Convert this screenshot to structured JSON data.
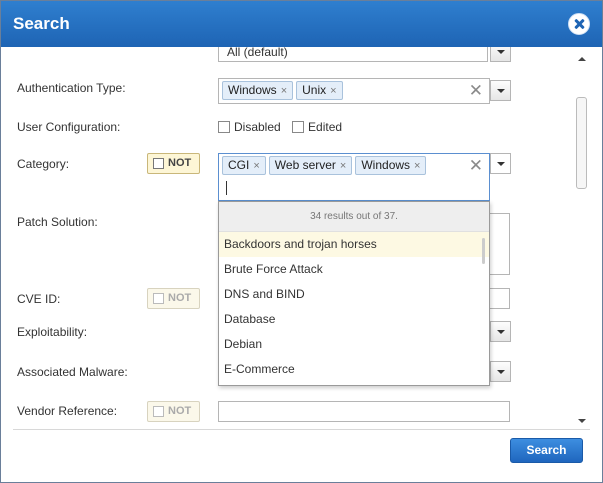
{
  "window": {
    "title": "Search"
  },
  "fields": {
    "top_partial_value": "All (default)",
    "auth_type_label": "Authentication Type:",
    "auth_tags": [
      "Windows",
      "Unix"
    ],
    "user_config_label": "User Configuration:",
    "user_config_options": [
      "Disabled",
      "Edited"
    ],
    "category_label": "Category:",
    "category_tags": [
      "CGI",
      "Web server",
      "Windows"
    ],
    "patch_label": "Patch Solution:",
    "cve_label": "CVE ID:",
    "exploit_label": "Exploitability:",
    "malware_label": "Associated Malware:",
    "vendor_label": "Vendor Reference:",
    "not_label": "NOT"
  },
  "dropdown": {
    "count_text": "34 results out of 37.",
    "items": [
      "Backdoors and trojan horses",
      "Brute Force Attack",
      "DNS and BIND",
      "Database",
      "Debian",
      "E-Commerce"
    ],
    "active_index": 0
  },
  "icons": {
    "close": "close-icon",
    "clear": "clear-x-icon",
    "dropdown": "chevron-down-icon",
    "tag_remove": "remove-x-icon"
  },
  "colors": {
    "titlebar": "#1e64b4",
    "accent": "#2f7fcf",
    "not_bg": "#fdf6d6",
    "active_item": "#fdf9e3"
  },
  "footer": {
    "search_label": "Search"
  },
  "glyphs": {
    "x": "×",
    "clear": "✕"
  }
}
